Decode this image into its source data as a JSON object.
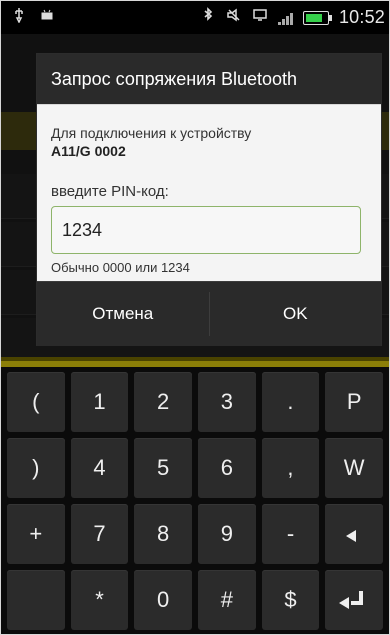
{
  "status_bar": {
    "time": "10:52",
    "left_icons": [
      "usb-icon",
      "android-icon"
    ],
    "right_icons": [
      "bluetooth-icon",
      "no-sound-icon",
      "display-icon",
      "signal-icon",
      "battery-icon"
    ]
  },
  "dialog": {
    "title": "Запрос сопряжения Bluetooth",
    "message_line1": "Для подключения к устройству",
    "device_name": "A11/G 0002",
    "prompt": "введите PIN-код:",
    "pin_value": "1234",
    "hint": "Обычно 0000 или 1234",
    "cancel_label": "Отмена",
    "ok_label": "OK"
  },
  "keypad": {
    "rows": [
      [
        "(",
        "1",
        "2",
        "3",
        ".",
        "P"
      ],
      [
        ")",
        "4",
        "5",
        "6",
        ",",
        "W"
      ],
      [
        "+",
        "7",
        "8",
        "9",
        "-",
        "backspace-icon"
      ],
      [
        "space-icon",
        "*",
        "0",
        "#",
        "$",
        "enter-icon"
      ]
    ]
  },
  "colors": {
    "accent_green": "#8eb46a",
    "keypad_accent": "#8b7f08"
  }
}
